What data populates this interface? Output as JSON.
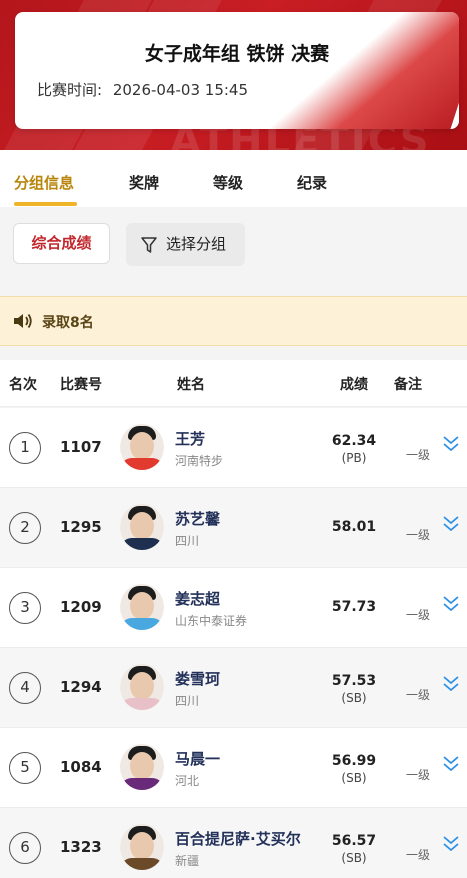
{
  "header": {
    "title": "女子成年组 铁饼 决赛",
    "time_label": "比赛时间:",
    "time_value": "2026-04-03  15:45",
    "watermark": "ATHLETICS"
  },
  "tabs": [
    {
      "label": "分组信息",
      "active": true
    },
    {
      "label": "奖牌"
    },
    {
      "label": "等级"
    },
    {
      "label": "纪录"
    }
  ],
  "filters": {
    "score_label": "综合成绩",
    "group_label": "选择分组"
  },
  "notice": {
    "icon": "speaker-icon",
    "text": "录取8名"
  },
  "table": {
    "headers": {
      "rank": "名次",
      "bib": "比赛号",
      "name": "姓名",
      "mark": "成绩",
      "note": "备注"
    },
    "rows": [
      {
        "rank": "1",
        "bib": "1107",
        "name": "王芳",
        "team": "河南特步",
        "mark": "62.34",
        "mark_note": "(PB)",
        "grade": "一级",
        "shirt": "#e23a2f"
      },
      {
        "rank": "2",
        "bib": "1295",
        "name": "苏艺馨",
        "team": "四川",
        "mark": "58.01",
        "mark_note": "",
        "grade": "一级",
        "shirt": "#1f2f4f"
      },
      {
        "rank": "3",
        "bib": "1209",
        "name": "姜志超",
        "team": "山东中泰证券",
        "mark": "57.73",
        "mark_note": "",
        "grade": "一级",
        "shirt": "#4aa8e0"
      },
      {
        "rank": "4",
        "bib": "1294",
        "name": "娄雪珂",
        "team": "四川",
        "mark": "57.53",
        "mark_note": "(SB)",
        "grade": "一级",
        "shirt": "#e8c0c8"
      },
      {
        "rank": "5",
        "bib": "1084",
        "name": "马晨一",
        "team": "河北",
        "mark": "56.99",
        "mark_note": "(SB)",
        "grade": "一级",
        "shirt": "#6a2a7a"
      },
      {
        "rank": "6",
        "bib": "1323",
        "name": "百合提尼萨·艾买尔",
        "team": "新疆",
        "mark": "56.57",
        "mark_note": "(SB)",
        "grade": "一级",
        "shirt": "#6b4a2a"
      }
    ]
  },
  "colors": {
    "brand_red": "#c1272d",
    "tab_active": "#b8860b",
    "tab_underline": "#f0b429",
    "name_text": "#23315a",
    "chevron": "#2d8fe6"
  }
}
